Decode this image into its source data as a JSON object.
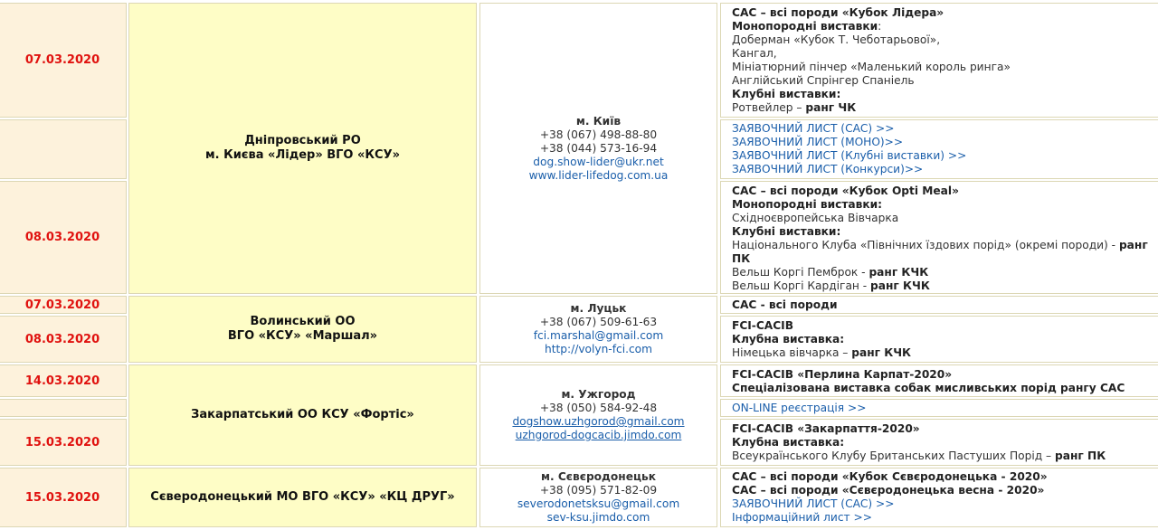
{
  "rows": {
    "kyiv": {
      "dates": [
        "07.03.2020",
        "",
        "08.03.2020"
      ],
      "org": [
        "Дніпровський РО",
        "м. Києва «Лідер» ВГО «КСУ»"
      ],
      "contact": {
        "city": "м. Київ",
        "phones": [
          "+38 (067) 498-88-80",
          "+38 (044) 573-16-94"
        ],
        "email": "dog.show-lider@ukr.net",
        "site": "www.lider-lifedog.com.ua"
      },
      "info1": {
        "title": "САС – всі породи «Кубок Лідера»",
        "mono_head": "Монопородні виставки",
        "mono_colon": ":",
        "mono": [
          "Доберман «Кубок Т. Чеботарьової»,",
          "Кангал,",
          "Мініатюрний пінчер «Маленький король ринга»",
          "Англійський Спрінгер Спаніель"
        ],
        "club_head": "Клубні виставки:",
        "club_text": "Ротвейлер – ",
        "club_rank": "ранг ЧК"
      },
      "links": [
        "ЗАЯВОЧНИЙ ЛИСТ (САС) >>",
        "ЗАЯВОЧНИЙ ЛИСТ (МОНО)>>",
        "ЗАЯВОЧНИЙ ЛИСТ (Клубні виставки) >>",
        "ЗАЯВОЧНИЙ ЛИСТ (Конкурси)>>"
      ],
      "info2": {
        "title": "САС – всі породи «Кубок Opti Meal»",
        "mono_head": "Монопородні виставки:",
        "mono": "Східноєвропейська Вівчарка",
        "club_head": "Клубні виставки:",
        "club1_text": "Національного Клуба «Північних їздових порід» (окремі породи) - ",
        "club1_rank_a": "ранг",
        "club1_rank_b": "ПК",
        "club2_text": "Вельш Коргі Пемброк - ",
        "club2_rank": "ранг КЧК",
        "club3_text": "Вельш Коргі Кардіган - ",
        "club3_rank": "ранг КЧК"
      }
    },
    "volyn": {
      "dates": [
        "07.03.2020",
        "08.03.2020"
      ],
      "org": [
        "Волинський ОО",
        "ВГО «КСУ» «Маршал»"
      ],
      "contact": {
        "city": "м. Луцьк",
        "phone": "+38 (067) 509-61-63",
        "email": "fci.marshal@gmail.com",
        "site": "http://volyn-fci.com"
      },
      "info1": "САС - всі породи",
      "info2": {
        "title": "FCI-CACIB",
        "club_head": "Клубна виставка:",
        "club_text": "Німецька вівчарка – ",
        "club_rank": "ранг КЧК"
      }
    },
    "zakarpattia": {
      "dates": [
        "14.03.2020",
        "",
        "15.03.2020"
      ],
      "org": "Закарпатський ОО КСУ «Фортіс»",
      "contact": {
        "city": "м. Ужгород",
        "phone": "+38 (050) 584-92-48",
        "email": "dogshow.uzhgorod@gmail.com",
        "site": "uzhgorod-dogcacib.jimdo.com"
      },
      "info1": [
        "FCI-CACIB «Перлина Карпат-2020»",
        "Спеціалізована виставка собак мисливських порід рангу САС"
      ],
      "link": "ON-LINE реєстрація >>",
      "info2": {
        "title": "FCI-CACIB «Закарпаття-2020»",
        "club_head": "Клубна виставка:",
        "club_text": "Всеукраїнського Клубу Британських Пастуших Порід – ",
        "club_rank": "ранг ПК"
      }
    },
    "sievierodonetsk": {
      "dates": [
        "15.03.2020"
      ],
      "org": "Сєверодонецький МО ВГО «КСУ» «КЦ ДРУГ»",
      "contact": {
        "city": "м. Сєвєродонецьк",
        "phone": "+38 (095) 571-82-09",
        "email": "severodonetsksu@gmail.com",
        "site": "sev-ksu.jimdo.com"
      },
      "info": [
        "САС – всі породи «Кубок Сєвєродонецька - 2020»",
        "САС – всі породи «Сєвєродонецька весна - 2020»"
      ],
      "links": [
        "ЗАЯВОЧНИЙ ЛИСТ (САС) >>",
        "Інформаційний лист >>"
      ]
    }
  }
}
